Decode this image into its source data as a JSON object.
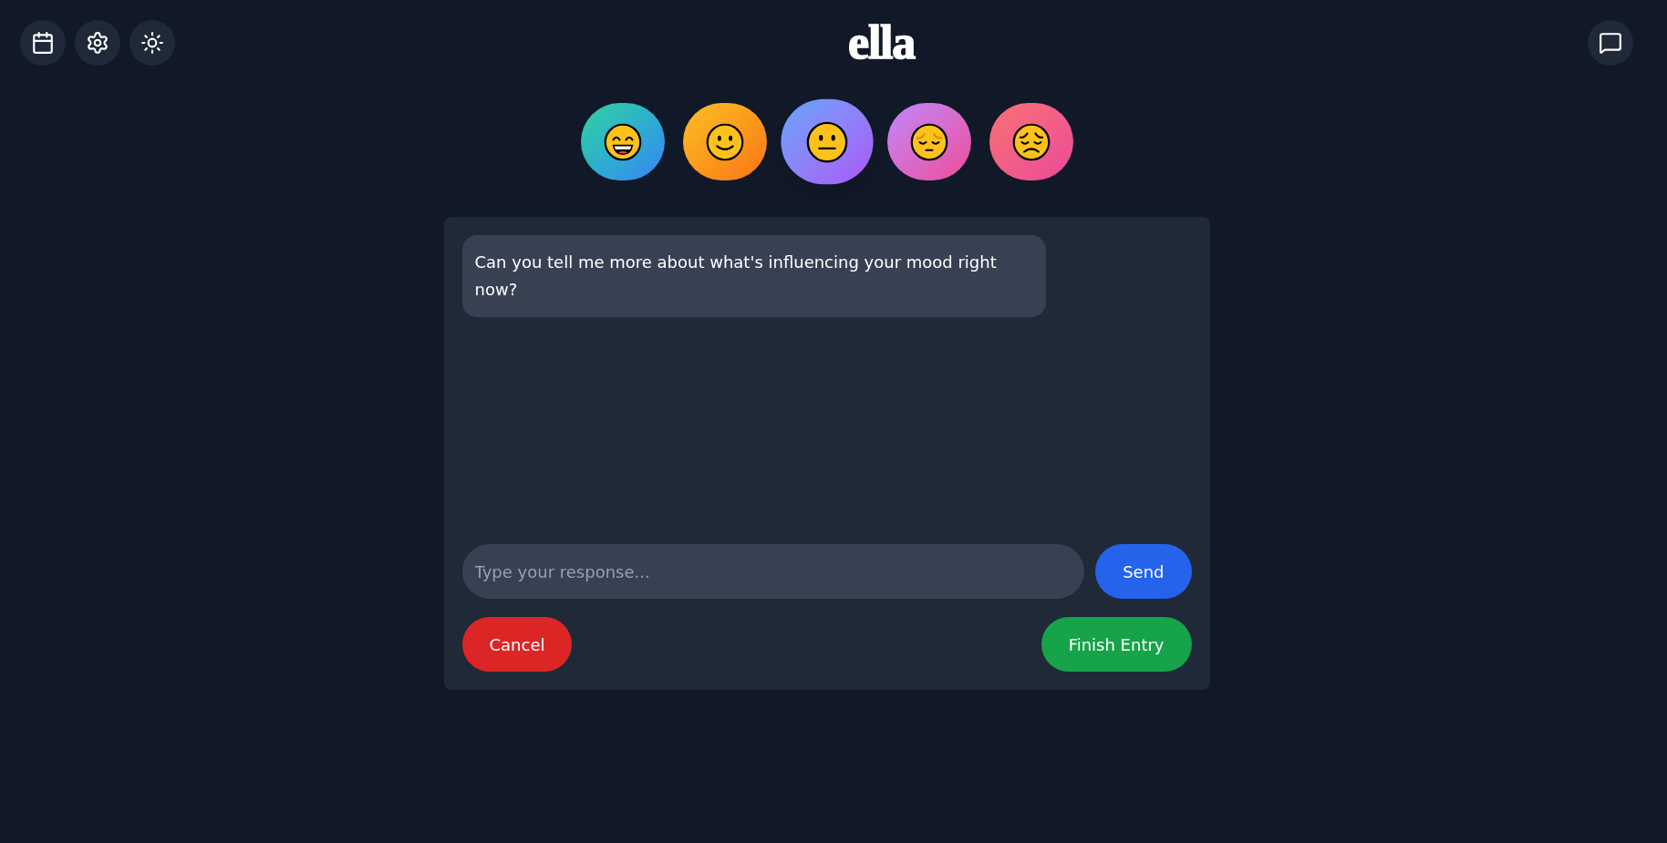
{
  "header": {
    "logo": "ella"
  },
  "moods": [
    {
      "kind": "grinning",
      "selected": false
    },
    {
      "kind": "smiling",
      "selected": false
    },
    {
      "kind": "neutral",
      "selected": true
    },
    {
      "kind": "pensive",
      "selected": false
    },
    {
      "kind": "sad",
      "selected": false
    }
  ],
  "chat": {
    "messages": [
      {
        "kind": "assistant",
        "text": "Can you tell me more about what's influencing your mood right now?"
      }
    ],
    "input": {
      "placeholder": "Type your response..."
    },
    "send_button": "Send"
  },
  "actions": {
    "cancel": "Cancel",
    "finish": "Finish Entry"
  }
}
